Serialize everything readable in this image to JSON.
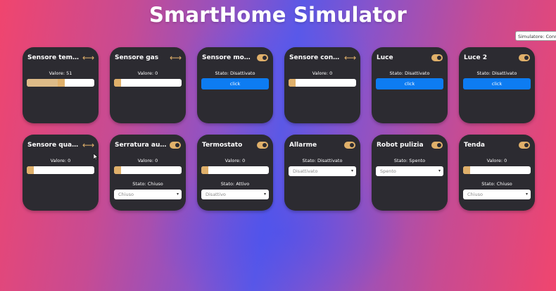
{
  "app": {
    "title": "SmartHome Simulator",
    "tooltip": "Simulatore: Connesso"
  },
  "colors": {
    "card_bg": "#2c2b31",
    "accent": "#e0b06a",
    "button_blue": "#0d7cf2"
  },
  "cards": [
    {
      "title": "Sensore temper…",
      "control": "arrows-icon",
      "value_text": "Valore: 51",
      "level": 0.51
    },
    {
      "title": "Sensore gas",
      "control": "arrows-icon",
      "value_text": "Valore: 0",
      "level": 0.0
    },
    {
      "title": "Sensore movim…",
      "control": "toggle-icon",
      "state_text": "Stato: Disattivato",
      "button": "click"
    },
    {
      "title": "Sensore conta p…",
      "control": "arrows-icon",
      "value_text": "Valore: 0",
      "level": 0.0
    },
    {
      "title": "Luce",
      "control": "toggle-icon",
      "state_text": "Stato: Disattivato",
      "button": "click"
    },
    {
      "title": "Luce 2",
      "control": "toggle-icon",
      "state_text": "Stato: Disattivato",
      "button": "click"
    },
    {
      "title": "Sensore qualità …",
      "control": "arrows-icon",
      "value_text": "Valore: 0",
      "level": 0.0
    },
    {
      "title": "Serratura autom…",
      "control": "toggle-icon",
      "value_text": "Valore: 0",
      "level": 0.0,
      "state_text": "Stato: Chiuso",
      "select": "Chiuso"
    },
    {
      "title": "Termostato",
      "control": "toggle-icon",
      "value_text": "Valore: 0",
      "level": 0.0,
      "state_text": "Stato: Attivo",
      "select": "Disattivo"
    },
    {
      "title": "Allarme",
      "control": "toggle-icon",
      "state_text": "Stato: Disattivato",
      "select": "Disattivato"
    },
    {
      "title": "Robot pulizia",
      "control": "toggle-icon",
      "state_text": "Stato: Spento",
      "select": "Spento"
    },
    {
      "title": "Tenda",
      "control": "toggle-icon",
      "value_text": "Valore: 0",
      "level": 0.0,
      "state_text": "Stato: Chiuso",
      "select": "Chiuso"
    }
  ]
}
